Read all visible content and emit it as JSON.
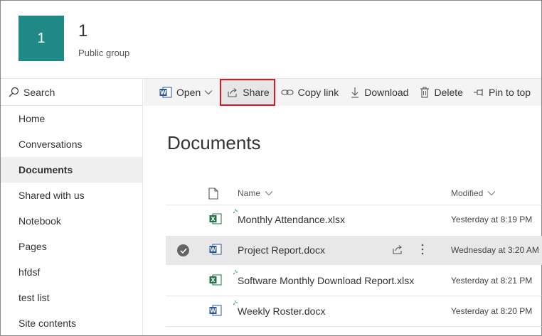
{
  "group": {
    "tile": "1",
    "title": "1",
    "subtitle": "Public group"
  },
  "search": {
    "label": "Search"
  },
  "nav": {
    "items": [
      {
        "label": "Home"
      },
      {
        "label": "Conversations"
      },
      {
        "label": "Documents"
      },
      {
        "label": "Shared with us"
      },
      {
        "label": "Notebook"
      },
      {
        "label": "Pages"
      },
      {
        "label": "hfdsf"
      },
      {
        "label": "test list"
      },
      {
        "label": "Site contents"
      }
    ],
    "active": "Documents"
  },
  "commands": {
    "open": "Open",
    "share": "Share",
    "copy_link": "Copy link",
    "download": "Download",
    "delete": "Delete",
    "pin": "Pin to top"
  },
  "library": {
    "title": "Documents",
    "columns": {
      "name": "Name",
      "modified": "Modified"
    },
    "files": [
      {
        "name": "Monthly Attendance.xlsx",
        "type": "excel",
        "modified": "Yesterday at 8:19 PM",
        "new": true,
        "selected": false
      },
      {
        "name": "Project Report.docx",
        "type": "word",
        "modified": "Wednesday at 3:20 AM",
        "new": false,
        "selected": true
      },
      {
        "name": "Software Monthly Download Report.xlsx",
        "type": "excel",
        "modified": "Yesterday at 8:21 PM",
        "new": true,
        "selected": false
      },
      {
        "name": "Weekly Roster.docx",
        "type": "word",
        "modified": "Yesterday at 8:20 PM",
        "new": true,
        "selected": false
      }
    ]
  },
  "colors": {
    "tile": "#1f8a85",
    "highlight": "#e0141e",
    "word": "#2b579a",
    "excel": "#217346"
  }
}
